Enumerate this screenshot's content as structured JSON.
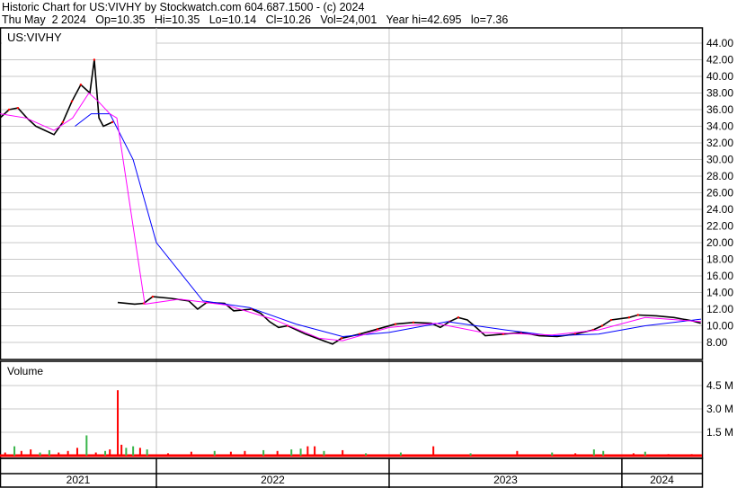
{
  "header": {
    "title": "Historic Chart for US:VIVHY by Stockwatch.com 604.687.1500 - (c) 2024",
    "quote": "Thu May  2 2024   Op=10.35   Hi=10.35   Lo=10.14   Cl=10.26   Vol=24,001   Year hi=42.695   lo=7.36"
  },
  "colors": {
    "price": "#000000",
    "up": "#ff0000",
    "ma_short": "#ff00ff",
    "ma_long": "#0000ff",
    "vol_up": "#39b54a",
    "vol_down": "#ff0000",
    "grid": "#c8c8c8"
  },
  "chart_data": {
    "type": "line",
    "symbol": "US:VIVHY",
    "ylabel_volume": "Volume",
    "xlim": [
      2021.328,
      2024.344
    ],
    "ylim": [
      7,
      45
    ],
    "y_ticks": [
      "44.00",
      "42.00",
      "40.00",
      "38.00",
      "36.00",
      "34.00",
      "32.00",
      "30.00",
      "28.00",
      "26.00",
      "24.00",
      "22.00",
      "20.00",
      "18.00",
      "16.00",
      "14.00",
      "12.00",
      "10.00",
      "8.00"
    ],
    "x_ticks": [
      {
        "t": 2021,
        "label": "2021"
      },
      {
        "t": 2022,
        "label": "2022"
      },
      {
        "t": 2023,
        "label": "2023"
      },
      {
        "t": 2024,
        "label": "2024"
      }
    ],
    "vol_ticks": [
      {
        "v": 4.5,
        "label": "4.5 M"
      },
      {
        "v": 3.0,
        "label": "3.0 M"
      },
      {
        "v": 1.5,
        "label": "1.5 M"
      }
    ],
    "vol_max": 6.0,
    "price": [
      [
        2021.328,
        35
      ],
      [
        2021.367,
        36
      ],
      [
        2021.405,
        36.2
      ],
      [
        2021.444,
        35
      ],
      [
        2021.482,
        34
      ],
      [
        2021.521,
        33.5
      ],
      [
        2021.56,
        33
      ],
      [
        2021.598,
        34.5
      ],
      [
        2021.637,
        37
      ],
      [
        2021.675,
        39
      ],
      [
        2021.714,
        38
      ],
      [
        2021.733,
        42
      ],
      [
        2021.753,
        35
      ],
      [
        2021.772,
        34
      ],
      [
        2021.811,
        34.5
      ],
      null,
      [
        2021.834,
        12.8
      ],
      [
        2021.907,
        12.6
      ],
      [
        2021.946,
        12.7
      ],
      [
        2021.984,
        13.5
      ],
      [
        2022.062,
        13.3
      ],
      [
        2022.139,
        13
      ],
      [
        2022.177,
        12
      ],
      [
        2022.216,
        12.8
      ],
      [
        2022.293,
        12.7
      ],
      [
        2022.332,
        11.8
      ],
      [
        2022.409,
        12
      ],
      [
        2022.448,
        11.5
      ],
      [
        2022.486,
        10.5
      ],
      [
        2022.525,
        9.8
      ],
      [
        2022.564,
        10
      ],
      [
        2022.641,
        9
      ],
      [
        2022.718,
        8.2
      ],
      [
        2022.757,
        7.8
      ],
      [
        2022.795,
        8.5
      ],
      [
        2022.873,
        9
      ],
      [
        2022.95,
        9.6
      ],
      [
        2023.027,
        10.2
      ],
      [
        2023.104,
        10.4
      ],
      [
        2023.181,
        10.3
      ],
      [
        2023.22,
        9.8
      ],
      [
        2023.259,
        10.5
      ],
      [
        2023.297,
        11
      ],
      [
        2023.336,
        10.7
      ],
      [
        2023.374,
        9.8
      ],
      [
        2023.413,
        8.8
      ],
      [
        2023.49,
        9
      ],
      [
        2023.567,
        9.2
      ],
      [
        2023.645,
        8.8
      ],
      [
        2023.722,
        8.7
      ],
      [
        2023.799,
        9
      ],
      [
        2023.876,
        9.5
      ],
      [
        2023.915,
        10
      ],
      [
        2023.954,
        10.7
      ],
      [
        2024.031,
        11
      ],
      [
        2024.069,
        11.3
      ],
      [
        2024.147,
        11.2
      ],
      [
        2024.224,
        11
      ],
      [
        2024.262,
        10.8
      ],
      [
        2024.301,
        10.6
      ],
      [
        2024.339,
        10.3
      ]
    ],
    "ma_short": [
      [
        2021.328,
        35.5
      ],
      [
        2021.44,
        35
      ],
      [
        2021.56,
        33.5
      ],
      [
        2021.64,
        35
      ],
      [
        2021.71,
        38
      ],
      [
        2021.75,
        37
      ],
      [
        2021.8,
        35.5
      ],
      [
        2021.83,
        35
      ],
      [
        2021.95,
        12.6
      ],
      [
        2022.1,
        13.2
      ],
      [
        2022.3,
        12.5
      ],
      [
        2022.5,
        10.8
      ],
      [
        2022.7,
        8.5
      ],
      [
        2022.8,
        8.2
      ],
      [
        2023.0,
        9.8
      ],
      [
        2023.2,
        10.3
      ],
      [
        2023.4,
        9.2
      ],
      [
        2023.7,
        8.9
      ],
      [
        2023.9,
        9.5
      ],
      [
        2024.1,
        11
      ],
      [
        2024.34,
        10.5
      ]
    ],
    "ma_long": [
      [
        2021.65,
        34
      ],
      [
        2021.72,
        35.5
      ],
      [
        2021.8,
        35.5
      ],
      [
        2021.9,
        30
      ],
      [
        2022.0,
        20
      ],
      [
        2022.2,
        13
      ],
      [
        2022.4,
        12.2
      ],
      [
        2022.6,
        10.2
      ],
      [
        2022.8,
        8.7
      ],
      [
        2023.0,
        9.2
      ],
      [
        2023.25,
        10.5
      ],
      [
        2023.5,
        9.5
      ],
      [
        2023.7,
        8.8
      ],
      [
        2023.9,
        9
      ],
      [
        2024.1,
        10
      ],
      [
        2024.34,
        10.8
      ]
    ],
    "volume": [
      [
        2021.35,
        0.2,
        "d"
      ],
      [
        2021.39,
        0.6,
        "u"
      ],
      [
        2021.42,
        0.3,
        "d"
      ],
      [
        2021.46,
        0.4,
        "d"
      ],
      [
        2021.5,
        0.2,
        "u"
      ],
      [
        2021.54,
        0.35,
        "u"
      ],
      [
        2021.58,
        0.2,
        "d"
      ],
      [
        2021.62,
        0.3,
        "d"
      ],
      [
        2021.66,
        0.5,
        "d"
      ],
      [
        2021.7,
        1.3,
        "u"
      ],
      [
        2021.74,
        0.2,
        "d"
      ],
      [
        2021.78,
        0.3,
        "u"
      ],
      [
        2021.8,
        0.4,
        "d"
      ],
      [
        2021.834,
        4.2,
        "d"
      ],
      [
        2021.85,
        0.7,
        "d"
      ],
      [
        2021.87,
        0.5,
        "u"
      ],
      [
        2021.9,
        0.6,
        "u"
      ],
      [
        2021.93,
        0.5,
        "d"
      ],
      [
        2021.96,
        0.4,
        "u"
      ],
      [
        2022.05,
        0.15,
        "d"
      ],
      [
        2022.15,
        0.25,
        "d"
      ],
      [
        2022.25,
        0.3,
        "u"
      ],
      [
        2022.32,
        0.25,
        "d"
      ],
      [
        2022.38,
        0.3,
        "d"
      ],
      [
        2022.46,
        0.35,
        "u"
      ],
      [
        2022.52,
        0.3,
        "d"
      ],
      [
        2022.58,
        0.4,
        "u"
      ],
      [
        2022.62,
        0.45,
        "u"
      ],
      [
        2022.65,
        0.6,
        "d"
      ],
      [
        2022.68,
        0.6,
        "d"
      ],
      [
        2022.72,
        0.3,
        "u"
      ],
      [
        2022.8,
        0.35,
        "d"
      ],
      [
        2022.9,
        0.15,
        "u"
      ],
      [
        2023.05,
        0.2,
        "u"
      ],
      [
        2023.19,
        0.6,
        "d"
      ],
      [
        2023.35,
        0.15,
        "u"
      ],
      [
        2023.55,
        0.3,
        "d"
      ],
      [
        2023.7,
        0.2,
        "u"
      ],
      [
        2023.8,
        0.15,
        "d"
      ],
      [
        2023.88,
        0.4,
        "u"
      ],
      [
        2023.92,
        0.3,
        "u"
      ],
      [
        2024.05,
        0.15,
        "d"
      ],
      [
        2024.1,
        0.25,
        "u"
      ],
      [
        2024.2,
        0.1,
        "d"
      ],
      [
        2024.3,
        0.1,
        "d"
      ]
    ]
  }
}
